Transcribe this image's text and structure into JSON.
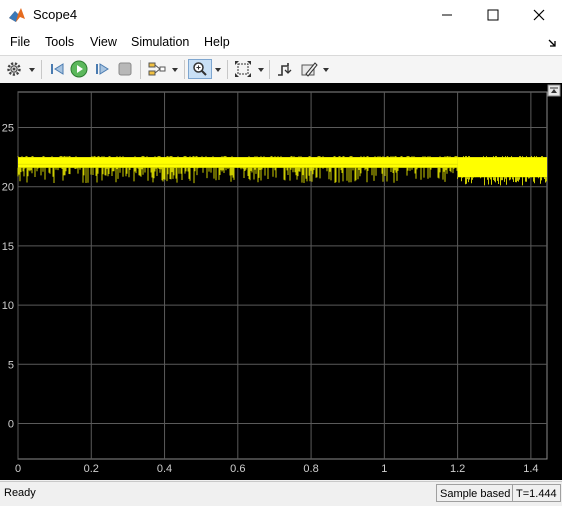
{
  "window": {
    "title": "Scope4",
    "icon": "matlab-icon",
    "controls": [
      "minimize-icon",
      "maximize-icon",
      "close-icon"
    ]
  },
  "menu": {
    "items": [
      "File",
      "Tools",
      "View",
      "Simulation",
      "Help"
    ],
    "undock_icon": "undock-arrow-icon"
  },
  "toolbar": {
    "icons": [
      "gear-icon",
      "step-back-icon",
      "run-icon",
      "step-forward-icon",
      "stop-icon",
      "signal-select-icon",
      "zoom-in-icon",
      "scale-axes-icon",
      "trigger-icon",
      "cursor-measure-icon"
    ]
  },
  "colors": {
    "plot_background": "#000000",
    "signal": "#ffff00",
    "grid": "#5a5a5a",
    "tick_labels": "#cfcfcf"
  },
  "chart_data": {
    "type": "line",
    "title": "",
    "xlabel": "",
    "ylabel": "",
    "xlim": [
      0,
      1.444
    ],
    "ylim": [
      -3,
      28
    ],
    "xticks": [
      "0",
      "0.2",
      "0.4",
      "0.6",
      "0.8",
      "1",
      "1.2",
      "1.4"
    ],
    "xtick_values": [
      0,
      0.2,
      0.4,
      0.6,
      0.8,
      1.0,
      1.2,
      1.4
    ],
    "yticks": [
      "0",
      "5",
      "10",
      "15",
      "20",
      "25"
    ],
    "ytick_values": [
      0,
      5,
      10,
      15,
      20,
      25
    ],
    "grid": true,
    "series": [
      {
        "color": "#ffff00",
        "description_values": {
          "upper_envelope": 22.5,
          "main_band_low": 21.6,
          "dip_low": 20.3
        },
        "segments": [
          {
            "x_start": 0.0,
            "x_end": 1.2,
            "low": 20.3,
            "high": 22.5,
            "core_low": 21.6,
            "core_high": 22.5
          },
          {
            "x_start": 1.2,
            "x_end": 1.444,
            "low": 20.1,
            "high": 22.5,
            "core_low": 20.8,
            "core_high": 22.5
          }
        ]
      }
    ]
  },
  "status": {
    "text": "Ready",
    "mode": "Sample based",
    "time": "T=1.444"
  }
}
